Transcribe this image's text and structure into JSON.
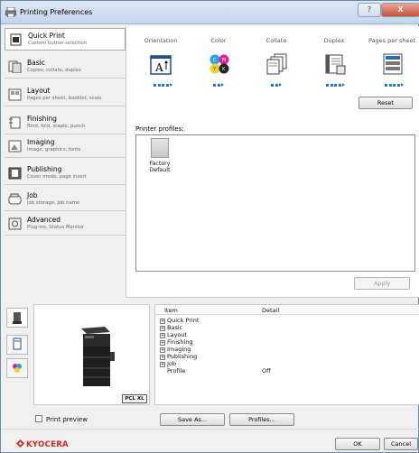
{
  "window": {
    "title": "Printing Preferences",
    "help_label": "?",
    "close_label": "X"
  },
  "sidebar": {
    "items": [
      {
        "title": "Quick Print",
        "subtitle": "Custom button selection",
        "icon": "quick-print-icon"
      },
      {
        "title": "Basic",
        "subtitle": "Copies, collate, duplex",
        "icon": "basic-icon"
      },
      {
        "title": "Layout",
        "subtitle": "Pages per sheet, booklet, scale",
        "icon": "layout-icon"
      },
      {
        "title": "Finishing",
        "subtitle": "Bind, fold, staple, punch",
        "icon": "finishing-icon"
      },
      {
        "title": "Imaging",
        "subtitle": "Image, graphics, fonts",
        "icon": "imaging-icon"
      },
      {
        "title": "Publishing",
        "subtitle": "Cover mode, page insert",
        "icon": "publishing-icon"
      },
      {
        "title": "Job",
        "subtitle": "Job storage, job name",
        "icon": "job-icon"
      },
      {
        "title": "Advanced",
        "subtitle": "Plug-ins, Status Monitor",
        "icon": "advanced-icon"
      }
    ]
  },
  "quick": {
    "columns": [
      "Orientation",
      "Color",
      "Collate",
      "Duplex",
      "Pages per sheet"
    ],
    "reset_label": "Reset"
  },
  "profiles": {
    "heading": "Printer profiles:",
    "items": [
      {
        "name_line1": "Factory",
        "name_line2": "Default"
      }
    ],
    "apply_label": "Apply"
  },
  "summary": {
    "headers": {
      "item": "Item",
      "detail": "Detail"
    },
    "rows": [
      {
        "label": "Quick Print",
        "detail": ""
      },
      {
        "label": "Basic",
        "detail": ""
      },
      {
        "label": "Layout",
        "detail": ""
      },
      {
        "label": "Finishing",
        "detail": ""
      },
      {
        "label": "Imaging",
        "detail": ""
      },
      {
        "label": "Publishing",
        "detail": ""
      },
      {
        "label": "Job",
        "detail": ""
      }
    ],
    "profile_row": {
      "label": "Profile",
      "detail": "Off"
    }
  },
  "printer_preview": {
    "badge": "PCL XL"
  },
  "bottom": {
    "print_preview_label": "Print preview",
    "save_as_label": "Save As...",
    "profiles_label": "Profiles...",
    "ok_label": "OK",
    "cancel_label": "Cancel",
    "brand": "KYOCERA"
  },
  "colors": {
    "accent": "#1f7bd1",
    "brand": "#d8251b"
  }
}
